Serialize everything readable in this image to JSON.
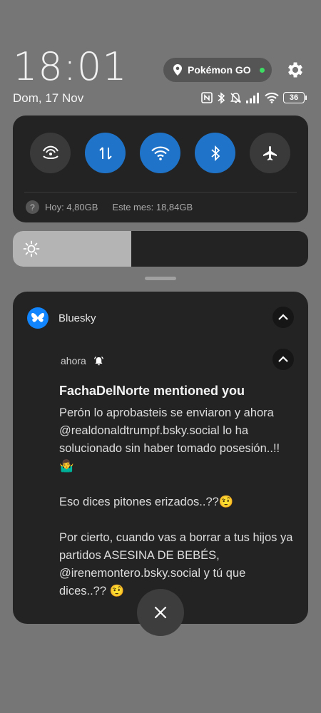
{
  "status": {
    "time": "18:01",
    "date": "Dom, 17 Nov",
    "active_app": "Pokémon GO",
    "battery": "36"
  },
  "quick_settings": {
    "data_today": "Hoy: 4,80GB",
    "data_month": "Este mes: 18,84GB",
    "toggles": [
      {
        "icon": "hotspot-icon",
        "on": false
      },
      {
        "icon": "mobile-data-icon",
        "on": true
      },
      {
        "icon": "wifi-icon",
        "on": true
      },
      {
        "icon": "bluetooth-icon",
        "on": true
      },
      {
        "icon": "airplane-mode-icon",
        "on": false
      }
    ]
  },
  "brightness": {
    "level": 0.4
  },
  "notification": {
    "app_name": "Bluesky",
    "time": "ahora",
    "title": "FachaDelNorte mentioned you",
    "body": "Perón lo aprobasteis se enviaron y ahora @realdonaldtrumpf.bsky.social lo ha solucionado sin haber tomado posesión..!! 🤷‍♂️\n\nEso dices pitones erizados..??🤨\n\nPor cierto, cuando vas a borrar a tus hijos ya partidos ASESINA DE BEBÉS, @irenemontero.bsky.social y tú que dices..?? 🤨"
  },
  "colors": {
    "background": "#767676",
    "panel": "#232323",
    "toggle_on": "#1f74c9",
    "accent_dot": "#3ddc63",
    "bluesky": "#1185fe"
  }
}
